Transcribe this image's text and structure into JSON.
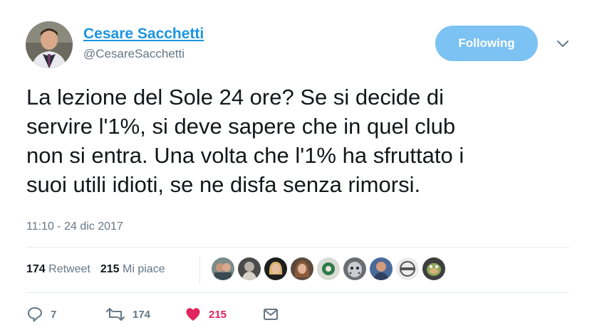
{
  "author": {
    "name": "Cesare Sacchetti",
    "handle": "@CesareSacchetti"
  },
  "follow_button_label": "Following",
  "tweet": {
    "lines": [
      "La lezione del Sole 24 ore? Se si decide di",
      "servire l'1%, si deve sapere che in quel club",
      "non si entra. Una volta che l'1% ha sfruttato i",
      "suoi utili idioti, se ne disfa senza rimorsi."
    ],
    "timestamp": "11:10 - 24 dic 2017"
  },
  "stats": {
    "retweets_count": "174",
    "retweets_label": "Retweet",
    "likes_count": "215",
    "likes_label": "Mi piace"
  },
  "likers": [
    {
      "icon": "avatar-liker-1"
    },
    {
      "icon": "avatar-liker-2"
    },
    {
      "icon": "avatar-liker-3"
    },
    {
      "icon": "avatar-liker-4"
    },
    {
      "icon": "avatar-liker-5"
    },
    {
      "icon": "avatar-liker-6"
    },
    {
      "icon": "avatar-liker-7"
    },
    {
      "icon": "avatar-liker-8"
    },
    {
      "icon": "avatar-liker-9"
    }
  ],
  "actions": {
    "reply_count": "7",
    "retweet_count": "174",
    "like_count": "215"
  },
  "colors": {
    "accent": "#1b95e0",
    "follow_button_bg": "#7cc2f2",
    "like_red": "#e0245e",
    "muted": "#657786",
    "text": "#14171a"
  }
}
